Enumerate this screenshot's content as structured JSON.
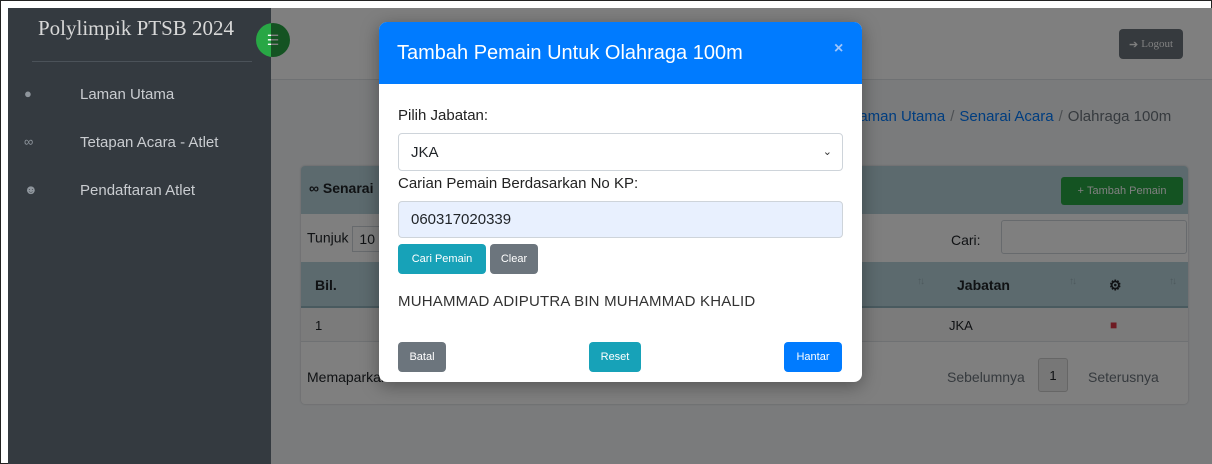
{
  "sidebar": {
    "brand": "Polylimpik PTSB 2024",
    "items": [
      {
        "label": "Laman Utama",
        "icon": "dashboard-icon"
      },
      {
        "label": "Tetapan Acara - Atlet",
        "icon": "link-icon"
      },
      {
        "label": "Pendaftaran Atlet",
        "icon": "users-icon"
      }
    ]
  },
  "topbar": {
    "logout_label": "Logout"
  },
  "breadcrumb": {
    "item1": "Laman Utama",
    "item2": "Senarai Acara",
    "current": "Olahraga 100m",
    "sep": "/"
  },
  "card": {
    "title": "Senarai",
    "add_button": "Tambah Pemain",
    "show_label": "Tunjuk",
    "show_value": "10",
    "search_label": "Cari:",
    "columns": {
      "bil": "Bil.",
      "jabatan": "Jabatan"
    },
    "rows": [
      {
        "bil": "1",
        "jabatan": "JKA"
      }
    ],
    "info_text": "Memaparkan",
    "prev_label": "Sebelumnya",
    "page": "1",
    "next_label": "Seterusnya"
  },
  "modal": {
    "title": "Tambah Pemain Untuk Olahraga 100m",
    "close": "×",
    "jabatan_label": "Pilih Jabatan:",
    "jabatan_value": "JKA",
    "search_label": "Carian Pemain Berdasarkan No KP:",
    "search_value": "060317020339",
    "find_button": "Cari Pemain",
    "clear_button": "Clear",
    "result_name": "MUHAMMAD ADIPUTRA BIN MUHAMMAD KHALID",
    "cancel_button": "Batal",
    "reset_button": "Reset",
    "submit_button": "Hantar"
  },
  "colors": {
    "primary": "#007bff",
    "info": "#17a2b8",
    "secondary": "#6c757d",
    "success": "#28a745",
    "danger": "#dc3545",
    "sidebar": "#343a40"
  }
}
